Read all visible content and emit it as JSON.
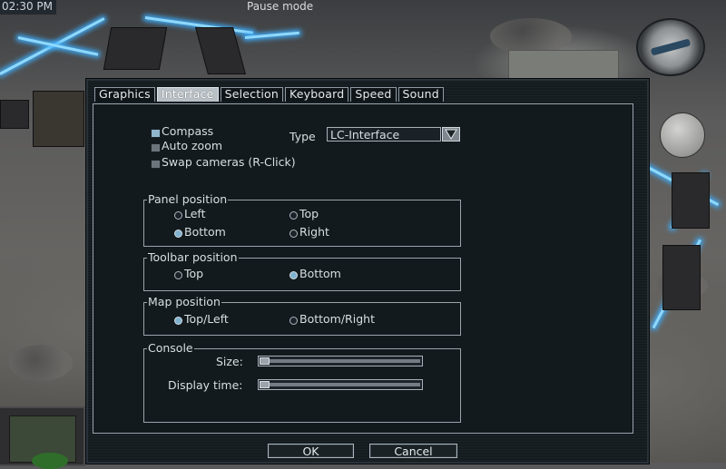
{
  "hud": {
    "time": "02:30 PM",
    "status": "Pause mode"
  },
  "tabs": [
    {
      "label": "Graphics",
      "active": false
    },
    {
      "label": "Interface",
      "active": true
    },
    {
      "label": "Selection",
      "active": false
    },
    {
      "label": "Keyboard",
      "active": false
    },
    {
      "label": "Speed",
      "active": false
    },
    {
      "label": "Sound",
      "active": false
    }
  ],
  "general": {
    "compass": {
      "label": "Compass",
      "checked": true
    },
    "auto_zoom": {
      "label": "Auto zoom",
      "checked": false
    },
    "swap_cameras": {
      "label": "Swap cameras (R-Click)",
      "checked": false
    },
    "type_label": "Type",
    "type_value": "LC-Interface"
  },
  "panel_position": {
    "title": "Panel position",
    "options": [
      "Left",
      "Top",
      "Bottom",
      "Right"
    ],
    "selected": "Bottom"
  },
  "toolbar_position": {
    "title": "Toolbar position",
    "options": [
      "Top",
      "Bottom"
    ],
    "selected": "Bottom"
  },
  "map_position": {
    "title": "Map position",
    "options": [
      "Top/Left",
      "Bottom/Right"
    ],
    "selected": "Top/Left"
  },
  "console": {
    "title": "Console",
    "size_label": "Size:",
    "size_value": 0,
    "display_time_label": "Display time:",
    "display_time_value": 0
  },
  "buttons": {
    "ok": "OK",
    "cancel": "Cancel"
  },
  "colors": {
    "window_bg": "#141c20",
    "accent": "#7fb2cf",
    "beam": "#8fd8ff"
  }
}
